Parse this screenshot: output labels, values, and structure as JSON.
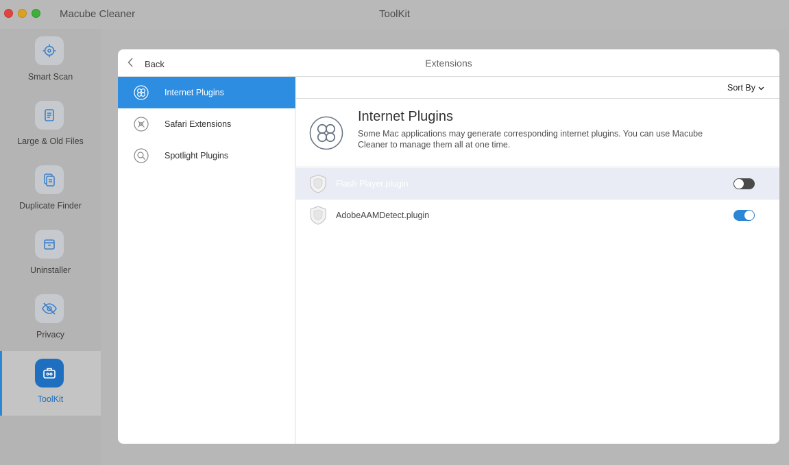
{
  "window": {
    "app_name": "Macube Cleaner",
    "title": "ToolKit"
  },
  "sidebar": {
    "items": [
      {
        "label": "Smart Scan",
        "icon": "target-icon"
      },
      {
        "label": "Large & Old Files",
        "icon": "document-icon"
      },
      {
        "label": "Duplicate Finder",
        "icon": "duplicate-icon"
      },
      {
        "label": "Uninstaller",
        "icon": "box-icon"
      },
      {
        "label": "Privacy",
        "icon": "eye-slash-icon"
      },
      {
        "label": "ToolKit",
        "icon": "toolkit-icon",
        "active": true
      }
    ]
  },
  "panel": {
    "back_label": "Back",
    "title": "Extensions",
    "categories": [
      {
        "label": "Internet Plugins",
        "icon": "clover-icon",
        "active": true
      },
      {
        "label": "Safari Extensions",
        "icon": "compass-icon"
      },
      {
        "label": "Spotlight Plugins",
        "icon": "magnifier-icon"
      }
    ],
    "sort_label": "Sort By",
    "intro": {
      "title": "Internet Plugins",
      "description": "Some Mac applications may generate corresponding internet plugins. You can use Macube Cleaner to manage them all at one time."
    },
    "plugins": [
      {
        "name": "Flash Player.plugin",
        "enabled": false,
        "highlighted": true
      },
      {
        "name": "AdobeAAMDetect.plugin",
        "enabled": true,
        "highlighted": false
      }
    ]
  },
  "colors": {
    "accent": "#2d8de0",
    "active_sidebar": "#1e6fbf",
    "toggle_off": "#4a4a4a"
  }
}
